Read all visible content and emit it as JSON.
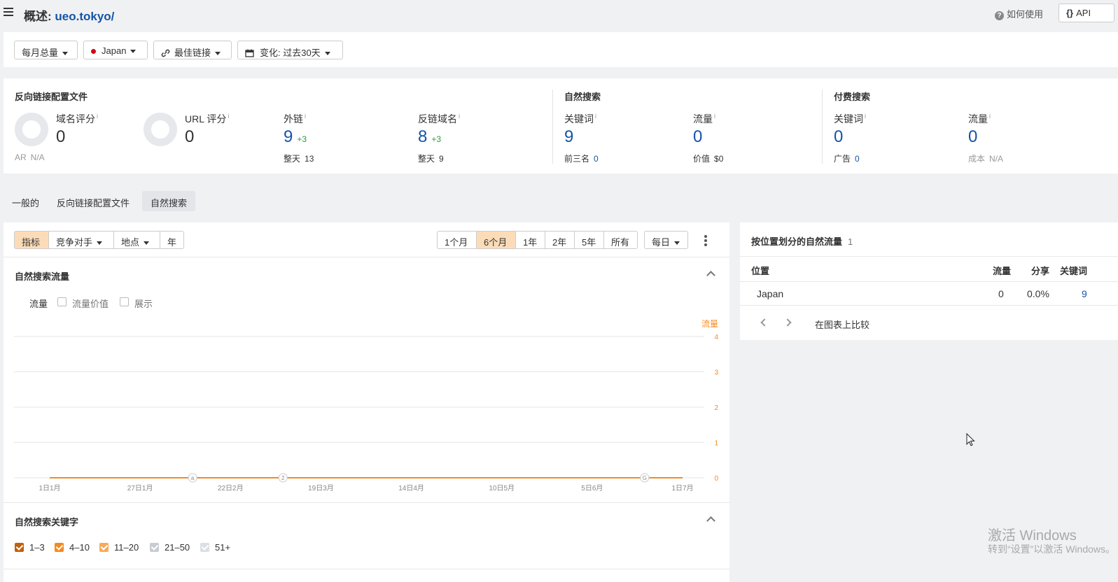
{
  "header": {
    "title_prefix": "概述: ",
    "title_domain": "ueo.tokyo/",
    "help_label": "如何使用",
    "help_glyph": "?",
    "api_braces": "{}",
    "api_label": "API"
  },
  "filters": {
    "volume": "每月总量",
    "country": "Japan",
    "links": "最佳链接",
    "change": "变化: 过去30天"
  },
  "metrics": {
    "backlink_profile_title": "反向链接配置文件",
    "dr_label": "域名评分",
    "dr_value": "0",
    "ar_label": "AR",
    "ar_value": "N/A",
    "ur_label": "URL 评分",
    "ur_value": "0",
    "backlinks_label": "外链",
    "backlinks_value": "9",
    "backlinks_delta": "+3",
    "backlinks_sub_label": "整天",
    "backlinks_sub_value": "13",
    "refdomains_label": "反链域名",
    "refdomains_value": "8",
    "refdomains_delta": "+3",
    "refdomains_sub_label": "整天",
    "refdomains_sub_value": "9",
    "organic_title": "自然搜索",
    "org_kw_label": "关键词",
    "org_kw_value": "9",
    "org_top3_label": "前三名",
    "org_top3_value": "0",
    "org_traffic_label": "流量",
    "org_traffic_value": "0",
    "org_value_label": "价值",
    "org_value_value": "$0",
    "paid_title": "付费搜索",
    "paid_kw_label": "关键词",
    "paid_kw_value": "0",
    "paid_ads_label": "广告",
    "paid_ads_value": "0",
    "paid_traffic_label": "流量",
    "paid_traffic_value": "0",
    "paid_cost_label": "成本",
    "paid_cost_value": "N/A",
    "info_glyph": "i"
  },
  "tabs": [
    {
      "label": "一般的"
    },
    {
      "label": "反向链接配置文件"
    },
    {
      "label": "自然搜索"
    }
  ],
  "chart_toolbar": {
    "metrics": "指标",
    "competitors": "竞争对手",
    "location": "地点",
    "year": "年",
    "ranges": [
      "1个月",
      "6个月",
      "1年",
      "2年",
      "5年",
      "所有"
    ],
    "granularity": "每日"
  },
  "traffic_section": {
    "title": "自然搜索流量",
    "checkboxes": [
      {
        "label": "流量",
        "checked": true
      },
      {
        "label": "流量价值",
        "checked": false
      },
      {
        "label": "展示",
        "checked": false
      }
    ]
  },
  "chart_data": {
    "type": "line",
    "series": [
      {
        "name": "流量",
        "values": [
          0,
          0,
          0,
          0,
          0,
          0,
          0,
          0
        ],
        "color": "#f48a1f"
      }
    ],
    "x": [
      "1日1月",
      "27日1月",
      "22日2月",
      "19日3月",
      "14日4月",
      "10日5月",
      "5日6月",
      "1日7月"
    ],
    "ylabel": "流量",
    "ylim": [
      0,
      4
    ],
    "yticks": [
      "0",
      "1",
      "2",
      "3",
      "4"
    ],
    "annotations": [
      {
        "label": "a",
        "x": "27日1月"
      },
      {
        "label": "2",
        "x": "22日2月"
      },
      {
        "label": "G",
        "x": "5日6月"
      }
    ],
    "grid": true
  },
  "keywords_section": {
    "title": "自然搜索关键字",
    "checkboxes": [
      {
        "label": "1–3",
        "checked": true,
        "color": "#c0610f"
      },
      {
        "label": "4–10",
        "checked": true,
        "color": "#f48a1f"
      },
      {
        "label": "11–20",
        "checked": true,
        "color": "#f6ab5a"
      },
      {
        "label": "21–50",
        "checked": true,
        "color": "#c8ccd2"
      },
      {
        "label": "51+",
        "checked": true,
        "color": "#dcdfe3"
      }
    ]
  },
  "location_panel": {
    "title": "按位置划分的自然流量",
    "count": "1",
    "headers": [
      "位置",
      "流量",
      "分享",
      "关键词"
    ],
    "rows": [
      {
        "location": "Japan",
        "traffic": "0",
        "share": "0.0%",
        "keywords": "9"
      }
    ],
    "compare_label": "在图表上比较"
  },
  "watermark": {
    "line1": "激活 Windows",
    "line2": "转到“设置”以激活 Windows。"
  },
  "colors": {
    "accent": "#f48a1f",
    "link": "#1454a8",
    "positive": "#2c9c3b"
  }
}
